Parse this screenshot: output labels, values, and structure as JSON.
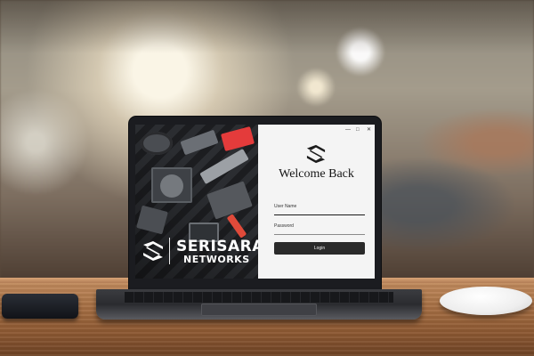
{
  "window": {
    "minimize_glyph": "—",
    "maximize_glyph": "□",
    "close_glyph": "✕"
  },
  "brand": {
    "name_line1": "SERISARA",
    "name_line2": "NETWORKS",
    "logo_icon": "serisara-s-logo-icon"
  },
  "login": {
    "title": "Welcome Back",
    "username_label": "User Name",
    "username_value": "",
    "password_label": "Password",
    "password_value": "",
    "login_button": "Login"
  },
  "colors": {
    "panel_bg": "#f4f4f4",
    "button_bg": "#2a2a2a",
    "text_dark": "#151515"
  }
}
